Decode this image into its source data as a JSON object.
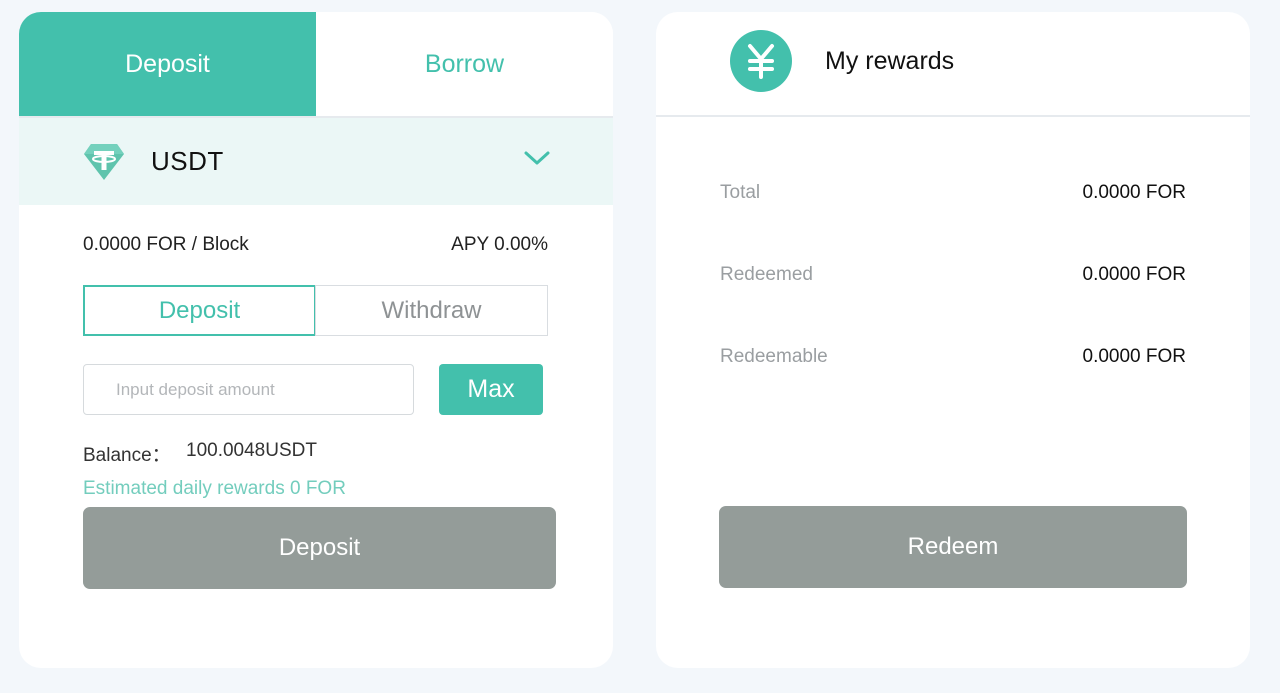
{
  "left_panel": {
    "tabs": [
      {
        "label": "Deposit",
        "active": true
      },
      {
        "label": "Borrow",
        "active": false
      }
    ],
    "asset": {
      "name": "USDT",
      "icon": "tether-icon"
    },
    "rate": "0.0000 FOR / Block",
    "apy": "APY 0.00%",
    "mode_tabs": [
      {
        "label": "Deposit",
        "active": true
      },
      {
        "label": "Withdraw",
        "active": false
      }
    ],
    "amount_input": {
      "value": "",
      "placeholder": "Input deposit amount"
    },
    "max_label": "Max",
    "balance_label": "Balance：",
    "balance_value": "100.0048USDT",
    "estimated_rewards": "Estimated daily rewards 0 FOR",
    "submit_label": "Deposit"
  },
  "right_panel": {
    "title": "My rewards",
    "icon": "yen-icon",
    "rows": [
      {
        "label": "Total",
        "value": "0.0000 FOR"
      },
      {
        "label": "Redeemed",
        "value": "0.0000 FOR"
      },
      {
        "label": "Redeemable",
        "value": "0.0000 FOR"
      }
    ],
    "redeem_label": "Redeem"
  },
  "colors": {
    "accent": "#43c0ac",
    "asset_row_bg": "#ebf7f6",
    "disabled_button": "#949c99",
    "page_bg": "#f3f7fb"
  }
}
